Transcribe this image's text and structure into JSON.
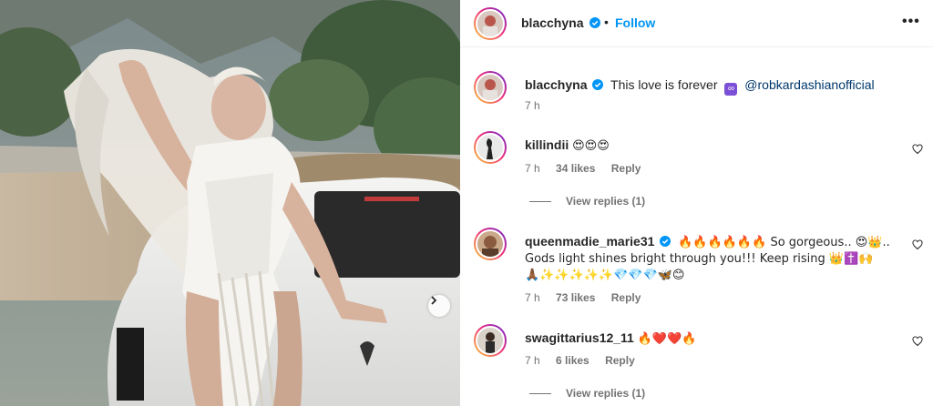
{
  "post": {
    "author": "blacchyna",
    "follow_label": "Follow",
    "dot": "•",
    "more_label": "•••",
    "caption_author": "blacchyna",
    "caption_text": "This love is forever",
    "caption_mention": "@robkardashianofficial",
    "caption_time": "7 h"
  },
  "comments": [
    {
      "username": "killindii",
      "text": "😍😍😍",
      "time": "7 h",
      "likes": "34 likes",
      "reply_label": "Reply",
      "view_replies": "View replies (1)"
    },
    {
      "username": "queenmadie_marie31",
      "verified": true,
      "line1": "🔥🔥🔥🔥🔥🔥 So gorgeous.. 😍👑..",
      "line2": "Gods light shines bright through you!!! Keep rising 👑✝️🙌",
      "line3": "🙏🏾✨✨✨✨✨💎💎💎🦋😊",
      "time": "7 h",
      "likes": "73 likes",
      "reply_label": "Reply"
    },
    {
      "username": "swagittarius12_11",
      "text": "🔥❤️❤️🔥",
      "time": "7 h",
      "likes": "6 likes",
      "reply_label": "Reply",
      "view_replies": "View replies (1)"
    }
  ],
  "colors": {
    "accent": "#0095f6",
    "verified": "#0095f6",
    "secondary_text": "#737373",
    "mention": "#00376b"
  },
  "icons": {
    "next": "chevron-right-icon",
    "like": "heart-outline-icon",
    "verified": "verified-badge-icon",
    "more": "more-options-icon"
  }
}
